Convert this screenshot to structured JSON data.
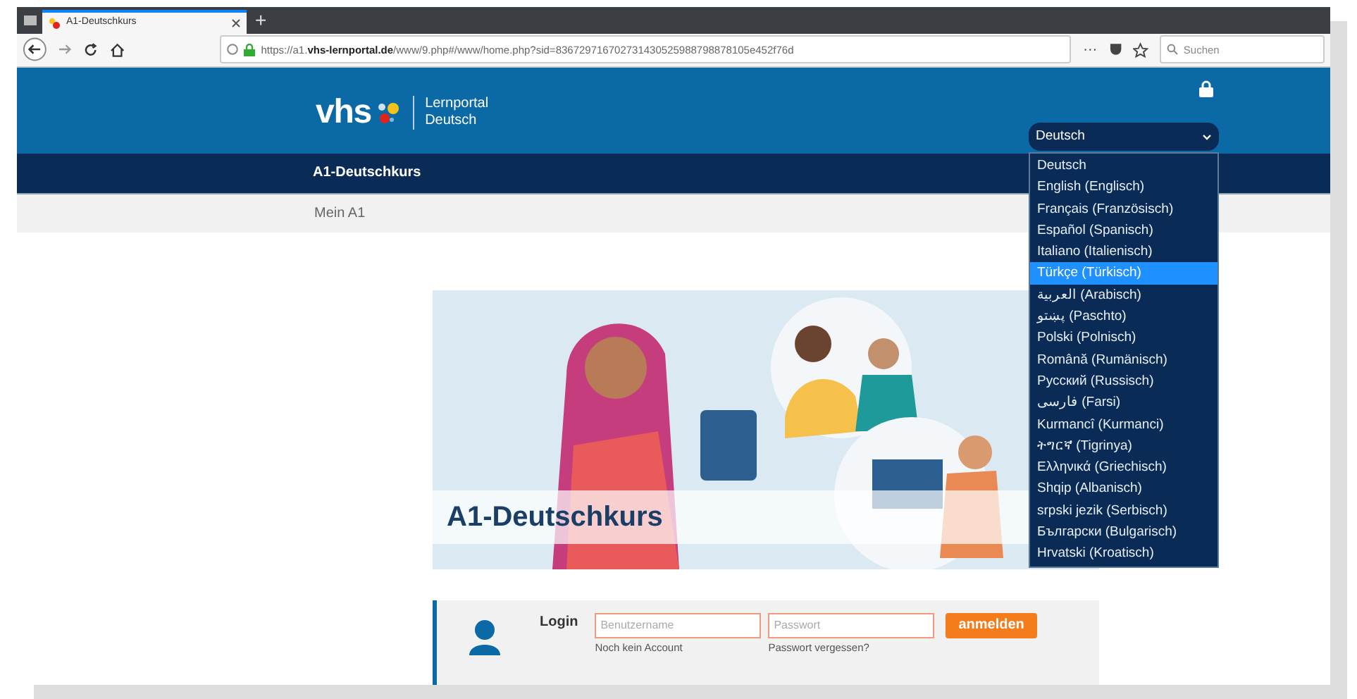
{
  "browser": {
    "tabs": [
      {
        "label": "A1-Deutschkurs",
        "selected": true
      }
    ],
    "new_tab": "+",
    "url_prefix": "https://a1.",
    "url_domain": "vhs-lernportal.de",
    "url_rest": "/www/9.php#/www/home.php?sid=836729716702731430525988798878105e452f76d",
    "more": "···",
    "search_placeholder": "Suchen"
  },
  "header": {
    "logo": "vhs",
    "portal_line1": "Lernportal",
    "portal_line2": "Deutsch"
  },
  "language_select": {
    "value": "Deutsch",
    "options": [
      {
        "label": "Deutsch",
        "highlighted": false
      },
      {
        "label": "English (Englisch)",
        "highlighted": false
      },
      {
        "label": "Français (Französisch)",
        "highlighted": false
      },
      {
        "label": "Español (Spanisch)",
        "highlighted": false
      },
      {
        "label": "Italiano (Italienisch)",
        "highlighted": false
      },
      {
        "label": "Türkçe (Türkisch)",
        "highlighted": true
      },
      {
        "label": "العربية (Arabisch)",
        "highlighted": false
      },
      {
        "label": "پښتو (Paschto)",
        "highlighted": false
      },
      {
        "label": "Polski (Polnisch)",
        "highlighted": false
      },
      {
        "label": "Română (Rumänisch)",
        "highlighted": false
      },
      {
        "label": "Русский (Russisch)",
        "highlighted": false
      },
      {
        "label": "فارسی (Farsi)",
        "highlighted": false
      },
      {
        "label": "Kurmancî (Kurmanci)",
        "highlighted": false
      },
      {
        "label": "ትግርኛ (Tigrinya)",
        "highlighted": false
      },
      {
        "label": "Ελληνικά (Griechisch)",
        "highlighted": false
      },
      {
        "label": "Shqip (Albanisch)",
        "highlighted": false
      },
      {
        "label": "srpski jezik (Serbisch)",
        "highlighted": false
      },
      {
        "label": "Български (Bulgarisch)",
        "highlighted": false
      },
      {
        "label": "Hrvatski (Kroatisch)",
        "highlighted": false
      }
    ]
  },
  "nav": {
    "main": "A1-Deutschkurs",
    "sub": "Mein A1"
  },
  "hero": {
    "title": "A1-Deutschkurs"
  },
  "login": {
    "title": "Login",
    "username_placeholder": "Benutzername",
    "password_placeholder": "Passwort",
    "button": "anmelden",
    "register_link": "Noch kein Account",
    "forgot_link": "Passwort vergessen?"
  }
}
